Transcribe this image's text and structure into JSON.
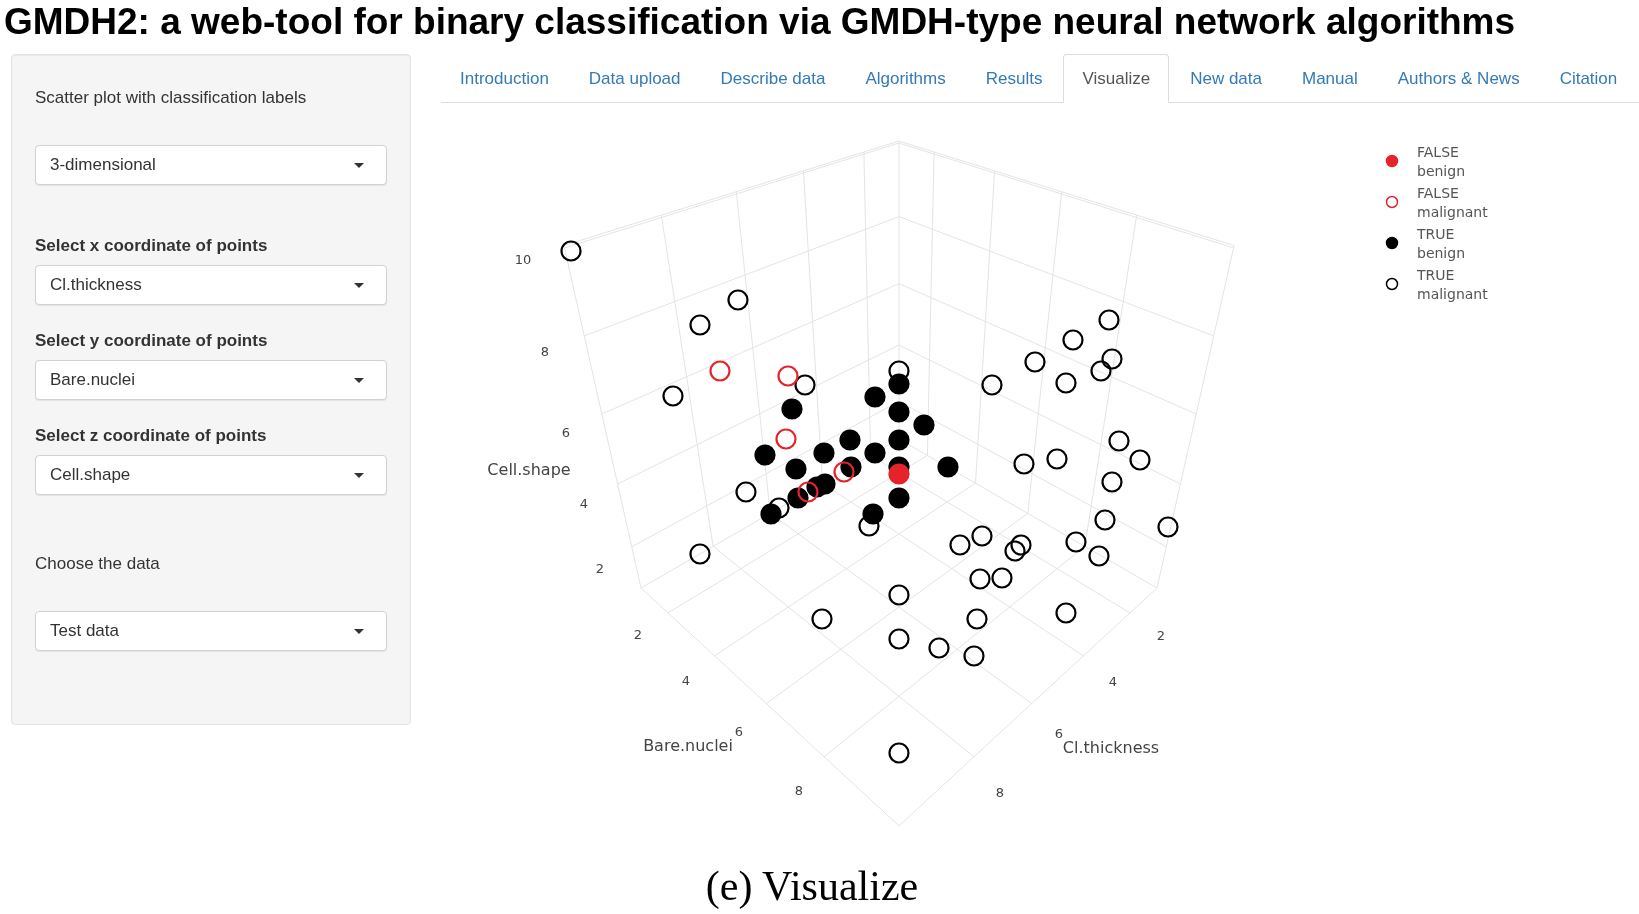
{
  "title": "GMDH2: a web-tool for binary classification via GMDH-type neural network algorithms",
  "sidebar": {
    "controls": [
      {
        "kind": "plain",
        "label": "Scatter plot with classification labels",
        "value": "3-dimensional"
      },
      {
        "kind": "strong",
        "label": "Select x coordinate of points",
        "value": "Cl.thickness"
      },
      {
        "kind": "strong",
        "label": "Select y coordinate of points",
        "value": "Bare.nuclei"
      },
      {
        "kind": "strong",
        "label": "Select z coordinate of points",
        "value": "Cell.shape"
      },
      {
        "kind": "plain",
        "label": "Choose the data",
        "value": "Test data"
      }
    ]
  },
  "tabs": [
    {
      "label": "Introduction",
      "selected": false
    },
    {
      "label": "Data upload",
      "selected": false
    },
    {
      "label": "Describe data",
      "selected": false
    },
    {
      "label": "Algorithms",
      "selected": false
    },
    {
      "label": "Results",
      "selected": false
    },
    {
      "label": "Visualize",
      "selected": true
    },
    {
      "label": "New data",
      "selected": false
    },
    {
      "label": "Manual",
      "selected": false
    },
    {
      "label": "Authors & News",
      "selected": false
    },
    {
      "label": "Citation",
      "selected": false
    }
  ],
  "plot": {
    "z_axis": {
      "title": "Cell.shape",
      "ticks": [
        "2",
        "4",
        "6",
        "8",
        "10"
      ]
    },
    "y_axis": {
      "title": "Bare.nuclei",
      "ticks": [
        "2",
        "4",
        "6",
        "8"
      ]
    },
    "x_axis": {
      "title": "Cl.thickness",
      "ticks": [
        "2",
        "4",
        "6",
        "8"
      ]
    },
    "legend": [
      {
        "lines": [
          "FALSE",
          "benign"
        ],
        "color": "#e6232b",
        "filled": true
      },
      {
        "lines": [
          "FALSE",
          "malignant"
        ],
        "color": "#e6232b",
        "filled": false
      },
      {
        "lines": [
          "TRUE",
          "benign"
        ],
        "color": "#000000",
        "filled": true
      },
      {
        "lines": [
          "TRUE",
          "malignant"
        ],
        "color": "#000000",
        "filled": false
      }
    ]
  },
  "caption": "(e) Visualize"
}
